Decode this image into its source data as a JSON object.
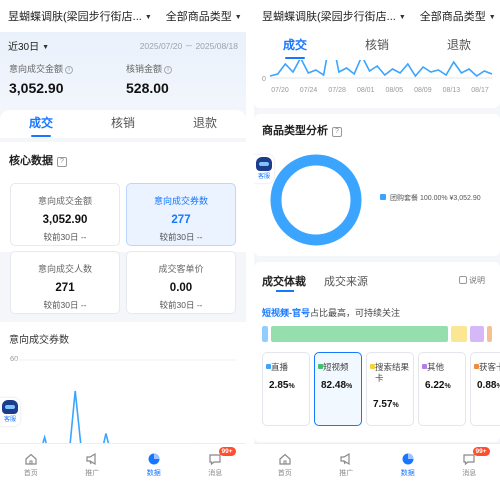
{
  "shop_name": "昱蝴蝶调肤(梁园步行街店...",
  "category_filter": "全部商品类型",
  "left": {
    "period": "近30日",
    "date_range": "2025/07/20 － 2025/08/18",
    "metric1_label": "意向成交金额",
    "metric1_value": "3,052.90",
    "metric2_label": "核销金额",
    "metric2_value": "528.00",
    "tabs": [
      "成交",
      "核销",
      "退款"
    ],
    "core_title": "核心数据",
    "kpis": [
      {
        "label": "意向成交金额",
        "value": "3,052.90",
        "compare": "较前30日 --"
      },
      {
        "label": "意向成交券数",
        "value": "277",
        "compare": "较前30日 --"
      },
      {
        "label": "意向成交人数",
        "value": "271",
        "compare": "较前30日 --"
      },
      {
        "label": "成交客单价",
        "value": "0.00",
        "compare": "较前30日 --"
      }
    ],
    "chart_title": "意向成交券数",
    "chart_tick_top": "60",
    "service_label": "客服"
  },
  "right": {
    "tabs": [
      "成交",
      "核销",
      "退款"
    ],
    "x_ticks": [
      "07/20",
      "07/24",
      "07/28",
      "08/01",
      "08/05",
      "08/09",
      "08/13",
      "08/17"
    ],
    "y_tick": "0",
    "type_title": "商品类型分析",
    "legend_text": "团购套餐 100.00%  ¥3,052.90",
    "service_label": "客服",
    "deal_tab_active": "成交体裁",
    "deal_tab_other": "成交来源",
    "explain_label": "说明",
    "highlight_prefix": "短视频-官号",
    "highlight_suffix": "占比最高，可持续关注",
    "sources": [
      {
        "name": "直播",
        "value": "2.85",
        "color": "#3ba4ff"
      },
      {
        "name": "短视频",
        "value": "82.48",
        "color": "#3cc46a"
      },
      {
        "name": "搜索结果卡",
        "value": "7.57",
        "color": "#f7d23a"
      },
      {
        "name": "其他",
        "value": "6.22",
        "color": "#b57cf0"
      },
      {
        "name": "获客卡",
        "value": "0.88",
        "color": "#f08a3c"
      }
    ],
    "pct_sign": "%"
  },
  "nav": [
    {
      "label": "首页",
      "icon": "home-icon"
    },
    {
      "label": "推广",
      "icon": "megaphone-icon"
    },
    {
      "label": "数据",
      "icon": "pie-chart-icon"
    },
    {
      "label": "消息",
      "icon": "message-icon"
    }
  ],
  "badge": "99+",
  "chart_data": [
    {
      "type": "line",
      "title": "意向成交券数",
      "ylim": [
        0,
        60
      ],
      "x": [
        "07/20",
        "07/21",
        "07/22",
        "07/23",
        "07/24",
        "07/25",
        "07/26",
        "07/27",
        "07/28",
        "07/29",
        "07/30",
        "07/31",
        "08/01",
        "08/02",
        "08/03",
        "08/04",
        "08/05",
        "08/06",
        "08/07",
        "08/08",
        "08/09",
        "08/10",
        "08/11",
        "08/12",
        "08/13",
        "08/14",
        "08/15",
        "08/16",
        "08/17",
        "08/18"
      ],
      "values": [
        2,
        4,
        14,
        6,
        20,
        5,
        8,
        3,
        44,
        6,
        10,
        4,
        22,
        7,
        12,
        3,
        9,
        5,
        14,
        2,
        11,
        6,
        8,
        3,
        16,
        5,
        9,
        2,
        7,
        4
      ]
    },
    {
      "type": "pie",
      "title": "商品类型分析",
      "categories": [
        "团购套餐"
      ],
      "values": [
        100.0
      ],
      "amounts": [
        "¥3,052.90"
      ]
    }
  ],
  "colors": {
    "accent": "#1677ff",
    "ring": "#3ba4ff",
    "badge": "#ff4d2e"
  }
}
